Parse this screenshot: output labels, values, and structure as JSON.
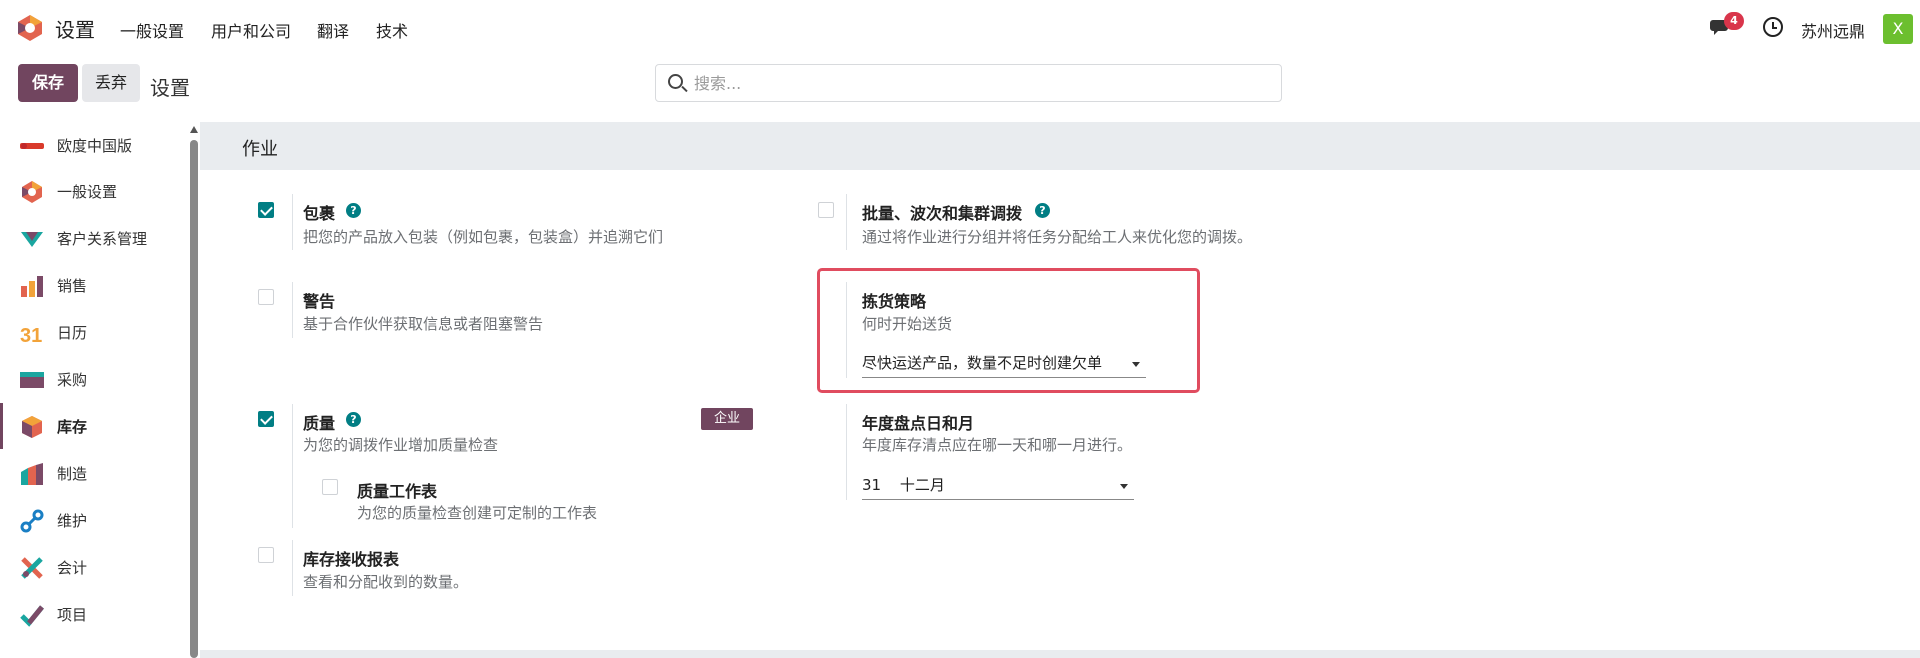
{
  "topbar": {
    "app_title": "设置",
    "menus": [
      "一般设置",
      "用户和公司",
      "翻译",
      "技术"
    ],
    "chat_badge": "4",
    "company": "苏州远鼎",
    "avatar_letter": "X",
    "icons": [
      "odoo-logo-icon",
      "chat-icon",
      "clock-icon"
    ]
  },
  "control": {
    "save_label": "保存",
    "discard_label": "丢弃",
    "title": "设置",
    "search_placeholder": "搜索..."
  },
  "sidebar": {
    "items": [
      {
        "label": "欧度中国版",
        "icon": "oudu-logo-icon"
      },
      {
        "label": "一般设置",
        "icon": "settings-app-icon"
      },
      {
        "label": "客户关系管理",
        "icon": "crm-icon"
      },
      {
        "label": "销售",
        "icon": "sales-icon"
      },
      {
        "label": "日历",
        "icon": "calendar-icon",
        "icon_text": "31"
      },
      {
        "label": "采购",
        "icon": "purchase-icon"
      },
      {
        "label": "库存",
        "icon": "inventory-icon",
        "active": true
      },
      {
        "label": "制造",
        "icon": "manufacturing-icon"
      },
      {
        "label": "维护",
        "icon": "maintenance-icon"
      },
      {
        "label": "会计",
        "icon": "accounting-icon"
      },
      {
        "label": "项目",
        "icon": "project-icon"
      }
    ]
  },
  "section": {
    "title": "作业",
    "options": {
      "packages": {
        "title": "包裹",
        "desc": "把您的产品放入包装（例如包裹，包装盒）并追溯它们",
        "checked": true
      },
      "batch": {
        "title": "批量、波次和集群调拨",
        "desc": "通过将作业进行分组并将任务分配给工人来优化您的调拨。",
        "checked": false
      },
      "warnings": {
        "title": "警告",
        "desc": "基于合作伙伴获取信息或者阻塞警告",
        "checked": false
      },
      "picking_policy": {
        "title": "拣货策略",
        "desc": "何时开始送货",
        "value": "尽快运送产品，数量不足时创建欠单"
      },
      "quality": {
        "title": "质量",
        "desc": "为您的调拨作业增加质量检查",
        "checked": true,
        "badge": "企业"
      },
      "quality_worksheet": {
        "title": "质量工作表",
        "desc": "为您的质量检查创建可定制的工作表",
        "checked": false
      },
      "annual_inventory": {
        "title": "年度盘点日和月",
        "desc": "年度库存清点应在哪一天和哪一月进行。",
        "day": "31",
        "month": "十二月"
      },
      "reception_report": {
        "title": "库存接收报表",
        "desc": "查看和分配收到的数量。",
        "checked": false
      }
    }
  },
  "colors": {
    "brand": "#71455f",
    "check": "#017e84",
    "highlight": "#e04c5f",
    "badge": "#d9354b"
  }
}
